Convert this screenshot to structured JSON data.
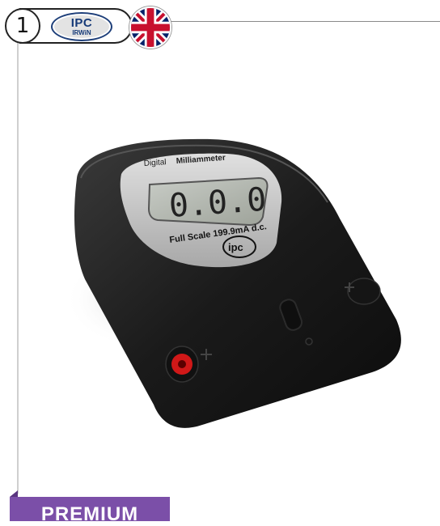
{
  "header": {
    "step_number": "1",
    "brand": {
      "name": "IPC",
      "subname": "IRWiN"
    },
    "language_flag": "uk-flag-icon"
  },
  "product": {
    "name_prefix": "Digital",
    "name_suffix": "Milliammeter",
    "display_value": "0.0.0",
    "scale_label": "Full Scale 199.9mA d.c.",
    "logo_text": "ipc"
  },
  "footer": {
    "badge": "PREMIUM"
  },
  "colors": {
    "badge_bg": "#7b4fa8",
    "brand_blue": "#163a78",
    "device_body": "#1c1c1c",
    "faceplate": "#c9c9c9",
    "terminal_red": "#d01818"
  }
}
